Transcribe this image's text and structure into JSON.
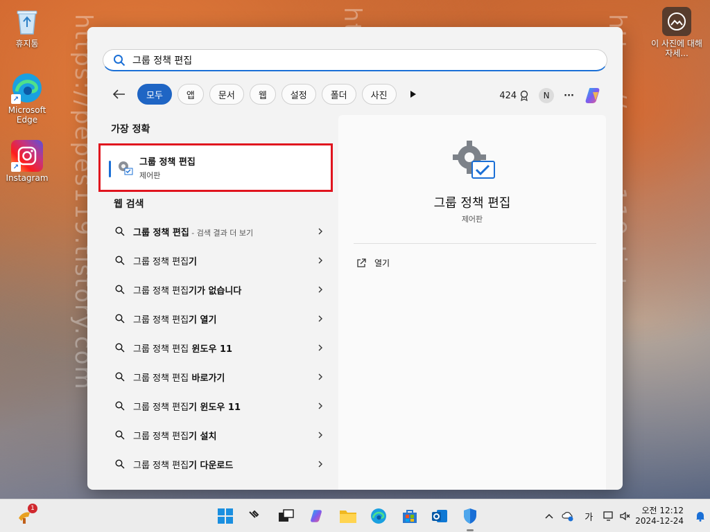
{
  "desktop": {
    "icons": [
      {
        "label": "휴지통"
      },
      {
        "label": "Microsoft Edge"
      },
      {
        "label": "Instagram"
      }
    ],
    "info_widget": {
      "label": "이 사진에 대해 자세..."
    }
  },
  "watermark": "https://pepes119.tistory.com",
  "search": {
    "query": "그룹 정책 편집",
    "filters": [
      "모두",
      "앱",
      "문서",
      "웹",
      "설정",
      "폴더",
      "사진"
    ],
    "active_filter": "모두",
    "points": "424",
    "avatar_initial": "N",
    "more": "···"
  },
  "best_match": {
    "section": "가장 정확",
    "title": "그룹 정책 편집",
    "subtitle": "제어판"
  },
  "web_search": {
    "section": "웹 검색",
    "items": [
      {
        "query": "그룹 정책 편집",
        "hint": " - 검색 결과 더 보기"
      },
      {
        "query": "그룹 정책 편집",
        "suffix": "기"
      },
      {
        "query": "그룹 정책 편집",
        "suffix": "기가 없습니다"
      },
      {
        "query": "그룹 정책 편집",
        "suffix": "기 열기"
      },
      {
        "query": "그룹 정책 편집",
        "suffix": " 윈도우 11"
      },
      {
        "query": "그룹 정책 편집",
        "suffix": " 바로가기"
      },
      {
        "query": "그룹 정책 편집",
        "suffix": "기 윈도우 11"
      },
      {
        "query": "그룹 정책 편집",
        "suffix": "기 설치"
      },
      {
        "query": "그룹 정책 편집",
        "suffix": "기 다운로드"
      }
    ]
  },
  "detail": {
    "title": "그룹 정책 편집",
    "subtitle": "제어판",
    "action_open": "열기"
  },
  "taskbar": {
    "ime": "가",
    "time": "오전 12:12",
    "date": "2024-12-24",
    "widget_badge": "1"
  }
}
